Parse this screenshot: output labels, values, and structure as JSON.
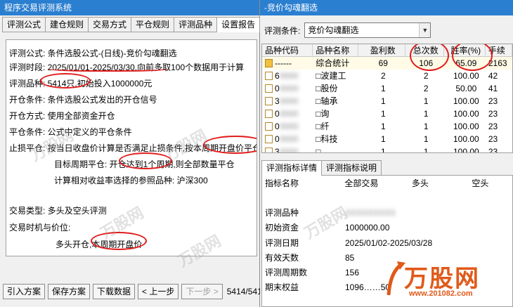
{
  "left": {
    "title": "程序交易评测系统",
    "tabs": [
      "评测公式",
      "建仓规则",
      "交易方式",
      "平仓规则",
      "评测品种",
      "设置报告"
    ],
    "active_tab": 5,
    "report_lines": [
      "评测公式:  条件选股公式-(日线)-竞价勾魂翻选",
      "评测时段:  2025/01/01-2025/03/30,向前多取100个数据用于计算",
      "评测品种:  5414只,初始投入1000000元",
      "开仓条件:  条件选股公式发出的开仓信号",
      "开仓方式:  使用全部资金开仓",
      "平仓条件:  公式中定义的平仓条件",
      "止损平仓:  按当日收盘价计算是否满足止损条件,按本周期开盘价平仓",
      "目标周期平仓:  开仓达到1个周期,则全部数量平仓",
      "计算相对收益率选择的参照品种:  沪深300",
      "交易类型:  多头及空头评测",
      "交易时机与价位:",
      "多头开仓,本周期开盘价"
    ],
    "buttons": [
      "引入方案",
      "保存方案",
      "下载数据",
      "< 上一步",
      "下一步 >"
    ],
    "page_info": "5414/541"
  },
  "right": {
    "title": "-竞价勾魂翻选",
    "criteria_label": "评测条件:",
    "criteria_value": "竞价勾魂翻选",
    "grid_headers": [
      "品种代码",
      "品种名称",
      "盈利数",
      "总次数",
      "胜率(%)",
      "手续"
    ],
    "grid_rows": [
      {
        "code": "------",
        "name": "综合统计",
        "profit": "69",
        "total": "106",
        "rate": "65.09",
        "fee": "2163"
      },
      {
        "code": "6",
        "name": "□波建工",
        "profit": "2",
        "total": "2",
        "rate": "100.00",
        "fee": "42"
      },
      {
        "code": "0",
        "name": "□股份",
        "profit": "1",
        "total": "2",
        "rate": "50.00",
        "fee": "41"
      },
      {
        "code": "3",
        "name": "□轴承",
        "profit": "1",
        "total": "1",
        "rate": "100.00",
        "fee": "23"
      },
      {
        "code": "0",
        "name": "□询",
        "profit": "1",
        "total": "1",
        "rate": "100.00",
        "fee": "23"
      },
      {
        "code": "0",
        "name": "□纤",
        "profit": "1",
        "total": "1",
        "rate": "100.00",
        "fee": "23"
      },
      {
        "code": "0",
        "name": "□科技",
        "profit": "1",
        "total": "1",
        "rate": "100.00",
        "fee": "23"
      },
      {
        "code": "3",
        "name": "□",
        "profit": "1",
        "total": "1",
        "rate": "100.00",
        "fee": "23"
      }
    ],
    "detail_tabs": [
      "评测指标详情",
      "评测指标说明"
    ],
    "detail_headers": [
      "指标名称",
      "全部交易",
      "多头",
      "空头"
    ],
    "detail_rows": [
      {
        "name": "",
        "val": ""
      },
      {
        "name": "评测品种",
        "val": ""
      },
      {
        "name": "初始资金",
        "val": "1000000.00"
      },
      {
        "name": "评测日期",
        "val": "2025/01/02-2025/03/28"
      },
      {
        "name": "有效天数",
        "val": "85"
      },
      {
        "name": "评测周期数",
        "val": "156"
      },
      {
        "name": "期末权益",
        "val": "1096……50"
      }
    ]
  },
  "watermark": {
    "brand": "万股网",
    "url": "www.201082.com",
    "brand_color": "#e05a1a"
  }
}
